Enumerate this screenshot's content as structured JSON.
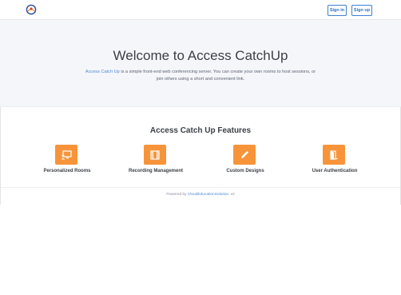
{
  "navbar": {
    "logo_icon": "catchup-logo-icon",
    "signin_label": "Sign in",
    "signup_label": "Sign up"
  },
  "hero": {
    "title": "Welcome to Access CatchUp",
    "desc_link": "Access Catch Up",
    "desc_rest": " is a simple front-end web conferencing server. You can create your own rooms to host sessions, or join others using a short and convenient link."
  },
  "features": {
    "title": "Access Catch Up Features",
    "items": [
      {
        "label": "Personalized Rooms",
        "icon": "desktop-user-icon"
      },
      {
        "label": "Recording Management",
        "icon": "film-icon"
      },
      {
        "label": "Custom Designs",
        "icon": "pencil-icon"
      },
      {
        "label": "User Authentication",
        "icon": "door-icon"
      }
    ]
  },
  "footer": {
    "prefix": "Powered by ",
    "brand": "CloudEducationSolution",
    "suffix": ". v2"
  },
  "colors": {
    "accent": "#f7943a",
    "link": "#4a8ad8",
    "hero_bg": "#f5f6fa"
  }
}
